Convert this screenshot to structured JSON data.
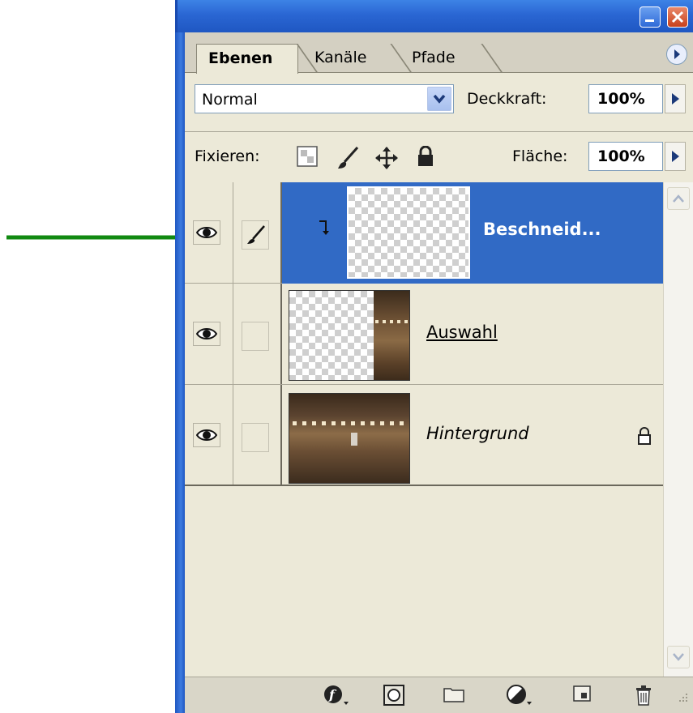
{
  "panel": {
    "tabs": [
      {
        "label": "Ebenen",
        "active": true
      },
      {
        "label": "Kanäle",
        "active": false
      },
      {
        "label": "Pfade",
        "active": false
      }
    ],
    "blend_mode": "Normal",
    "opacity_label": "Deckkraft:",
    "opacity_value": "100%",
    "lock_label": "Fixieren:",
    "fill_label": "Fläche:",
    "fill_value": "100%"
  },
  "layers": [
    {
      "name": "Beschneid...",
      "visible": true,
      "selected": true,
      "linked_icon": "brush-icon"
    },
    {
      "name": "Auswahl",
      "visible": true,
      "selected": false
    },
    {
      "name": "Hintergrund",
      "visible": true,
      "selected": false,
      "locked": true
    }
  ],
  "colors": {
    "selection": "#316ac5",
    "titlebar": "#2a66d3",
    "panel_bg": "#ece9d8",
    "annotation_arrow": "#118a11"
  },
  "icons": {
    "window": [
      "minimize-icon",
      "close-icon"
    ],
    "lock": [
      "lock-transparent-icon",
      "lock-image-brush-icon",
      "lock-position-move-icon",
      "lock-all-icon"
    ],
    "bottom": [
      "layer-style-icon",
      "layer-mask-icon",
      "new-group-folder-icon",
      "adjustment-layer-icon",
      "new-layer-icon",
      "trash-icon"
    ]
  }
}
